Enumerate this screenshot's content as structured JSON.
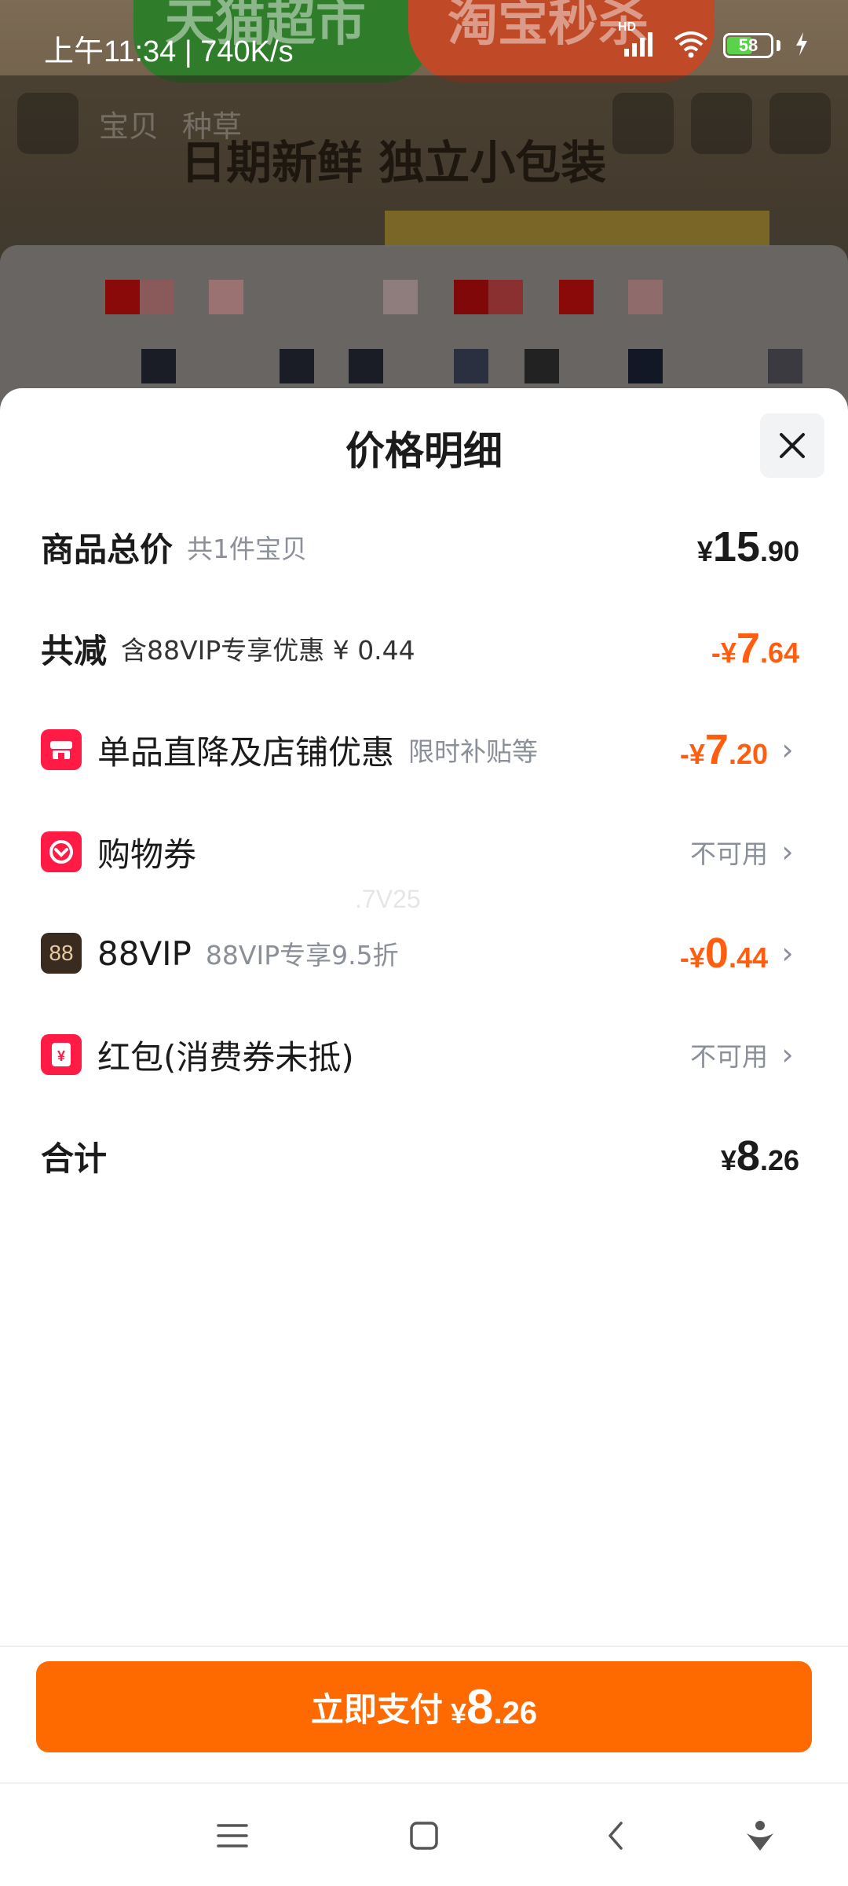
{
  "status_bar": {
    "time_speed": "上午11:34 | 740K/s",
    "hd_label": "HD",
    "battery": "58"
  },
  "background": {
    "banner_left": "天猫超市",
    "banner_right": "淘宝秒杀",
    "tabs": [
      "宝贝",
      "种草"
    ],
    "headline": "日期新鲜 独立小包装"
  },
  "sheet": {
    "title": "价格明细",
    "rows": [
      {
        "label": "商品总价",
        "sub": "共1件宝贝",
        "price": {
          "sym": "¥",
          "int": "15",
          "dec": ".90"
        }
      },
      {
        "label": "共减",
        "sub": "含88VIP专享优惠 ¥ 0.44",
        "price": {
          "sym": "-¥",
          "int": "7",
          "dec": ".64"
        }
      },
      {
        "label": "单品直降及店铺优惠",
        "sub": "限时补贴等",
        "price": {
          "sym": "-¥",
          "int": "7",
          "dec": ".20"
        }
      },
      {
        "label": "购物券",
        "status": "不可用"
      },
      {
        "label": "88VIP",
        "icon_text": "88",
        "sub": "88VIP专享9.5折",
        "price": {
          "sym": "-¥",
          "int": "0",
          "dec": ".44"
        }
      },
      {
        "label": "红包(消费券未抵)",
        "status": "不可用"
      },
      {
        "label": "合计",
        "price": {
          "sym": "¥",
          "int": "8",
          "dec": ".26"
        }
      }
    ],
    "watermark": ".7V25"
  },
  "pay_button": {
    "label": "立即支付",
    "sym": "¥",
    "int": "8",
    "dec": ".26"
  },
  "colors": {
    "accent_orange": "#ff6a00",
    "discount_orange": "#ff5d0f",
    "coupon_red": "#ff1b46"
  },
  "icons": [
    "store-icon",
    "coupon-icon",
    "vip88-icon",
    "red-packet-icon",
    "close-icon",
    "chevron-right-icon",
    "menu-icon",
    "home-icon",
    "back-icon",
    "assistant-icon"
  ]
}
